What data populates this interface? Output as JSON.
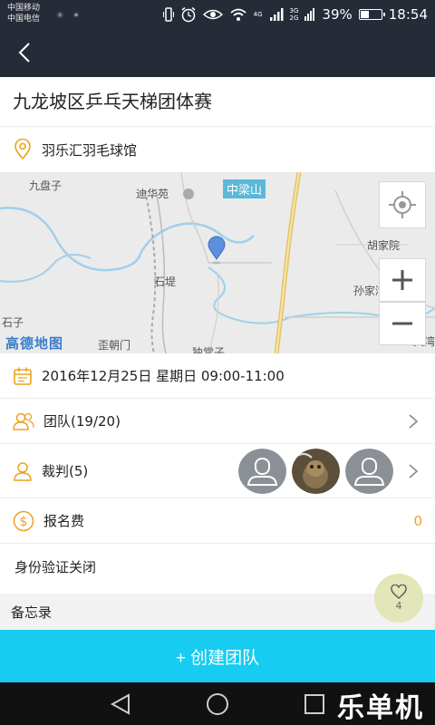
{
  "status_bar": {
    "carrier_1": "中国移动",
    "carrier_2": "中国电信",
    "network_small_1": "4G",
    "network_small_2_top": "3G",
    "network_small_2_bottom": "2G",
    "battery_percent": "39%",
    "battery_level": 0.39,
    "time": "18:54"
  },
  "navbar": {
    "back_icon": "chevron-left-icon"
  },
  "event": {
    "title": "九龙坡区乒乓天梯团体赛",
    "venue": "羽乐汇羽毛球馆",
    "date_time": "2016年12月25日 星期日 09:00-11:00",
    "teams_label": "团队(19/20)",
    "referees_label": "裁判(5)",
    "fee_label": "报名费",
    "fee_value": "0",
    "id_verify": "身份验证关闭",
    "memo_label": "备忘录"
  },
  "map": {
    "labels": {
      "jiupanzi": "九盘子",
      "dihuayuan": "迪华苑",
      "zhongliangshan": "中梁山",
      "hujiayuan": "胡家院",
      "shiti": "石堤",
      "sunjiawan": "孙家湾",
      "shizi": "石子",
      "waichaomen": "歪朝门",
      "dutang": "独堂子",
      "dawan": "大湾",
      "logo": "高德地图"
    }
  },
  "like": {
    "count": "4",
    "icon": "heart-icon"
  },
  "create_button": {
    "label": "+ 创建团队"
  },
  "watermark": "乐单机",
  "colors": {
    "header_bg": "#262b38",
    "accent_orange": "#f0a11e",
    "button_cyan": "#17ccf0",
    "like_bg": "#e2e6b8"
  }
}
